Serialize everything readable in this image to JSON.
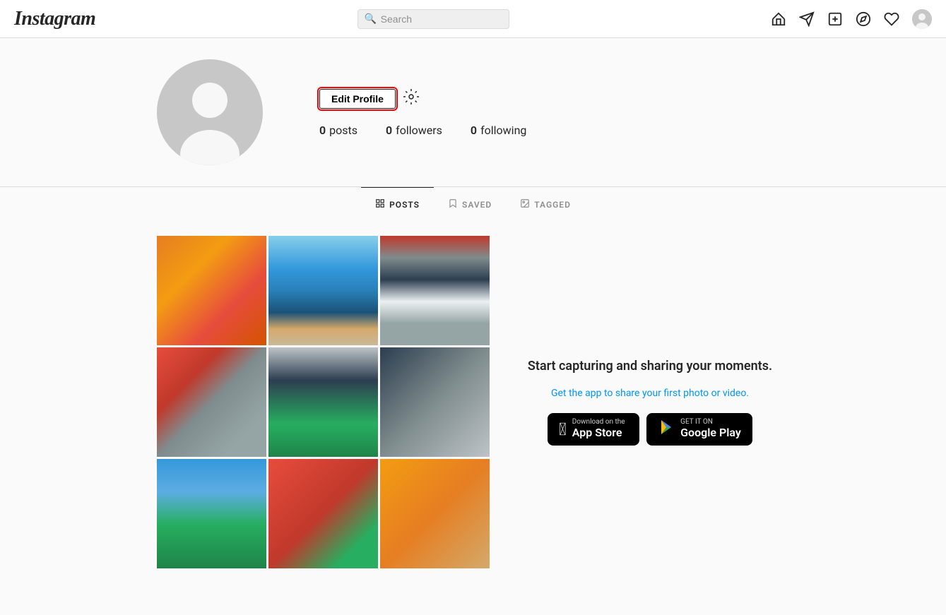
{
  "header": {
    "logo": "Instagram",
    "search_placeholder": "Search",
    "nav_icons": [
      "home-icon",
      "send-icon",
      "add-icon",
      "explore-icon",
      "heart-icon",
      "avatar-icon"
    ]
  },
  "profile": {
    "edit_button": "Edit Profile",
    "stats": {
      "posts_count": "0",
      "posts_label": "posts",
      "followers_count": "0",
      "followers_label": "followers",
      "following_count": "0",
      "following_label": "following"
    }
  },
  "tabs": [
    {
      "id": "posts",
      "label": "POSTS",
      "icon": "grid-icon",
      "active": true
    },
    {
      "id": "saved",
      "label": "SAVED",
      "icon": "bookmark-icon",
      "active": false
    },
    {
      "id": "tagged",
      "label": "TAGGED",
      "icon": "tag-icon",
      "active": false
    }
  ],
  "cta": {
    "title": "Start capturing and sharing your moments.",
    "subtitle": "Get the app to share your first photo or video.",
    "app_store_label_small": "Download on the",
    "app_store_label_large": "App Store",
    "google_play_label_small": "GET IT ON",
    "google_play_label_large": "Google Play"
  }
}
